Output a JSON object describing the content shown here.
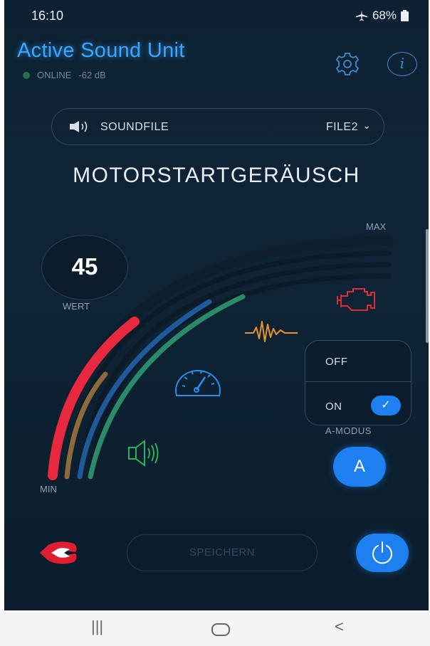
{
  "status_bar": {
    "time": "16:10",
    "battery": "68%",
    "icons": [
      "airplane-icon",
      "battery-icon"
    ]
  },
  "header": {
    "title": "Active Sound Unit",
    "connection": "ONLINE",
    "signal": "-62 dB"
  },
  "soundfile": {
    "label": "SOUNDFILE",
    "value": "FILE2",
    "icon": "speaker-icon"
  },
  "sound_name": "MOTORSTARTGERÄUSCH",
  "gauge": {
    "max_label": "MAX",
    "min_label": "MIN",
    "value": "45",
    "value_label": "WERT",
    "tracks": [
      {
        "name": "main",
        "color": "#e8283f",
        "level": 0.45
      },
      {
        "name": "waveform",
        "color": "#8c6a3e",
        "level": 0.25
      },
      {
        "name": "speed",
        "color": "#1f5a9a",
        "level": 0.6
      },
      {
        "name": "volume",
        "color": "#2b8a68",
        "level": 0.7
      }
    ],
    "icons": [
      "engine-icon",
      "waveform-icon",
      "speedometer-icon",
      "speaker-icon"
    ]
  },
  "mode": {
    "off": "OFF",
    "on": "ON",
    "selected": "ON",
    "label": "A-MODUS",
    "button": "A"
  },
  "save_label": "SPEICHERN",
  "colors": {
    "accent": "#1e7ff0",
    "title": "#3aa6ff",
    "background": "#0d2132",
    "engine": "#e02a3a",
    "wave": "#e8922a",
    "speed": "#2f8bea",
    "volume": "#2fb05a"
  }
}
